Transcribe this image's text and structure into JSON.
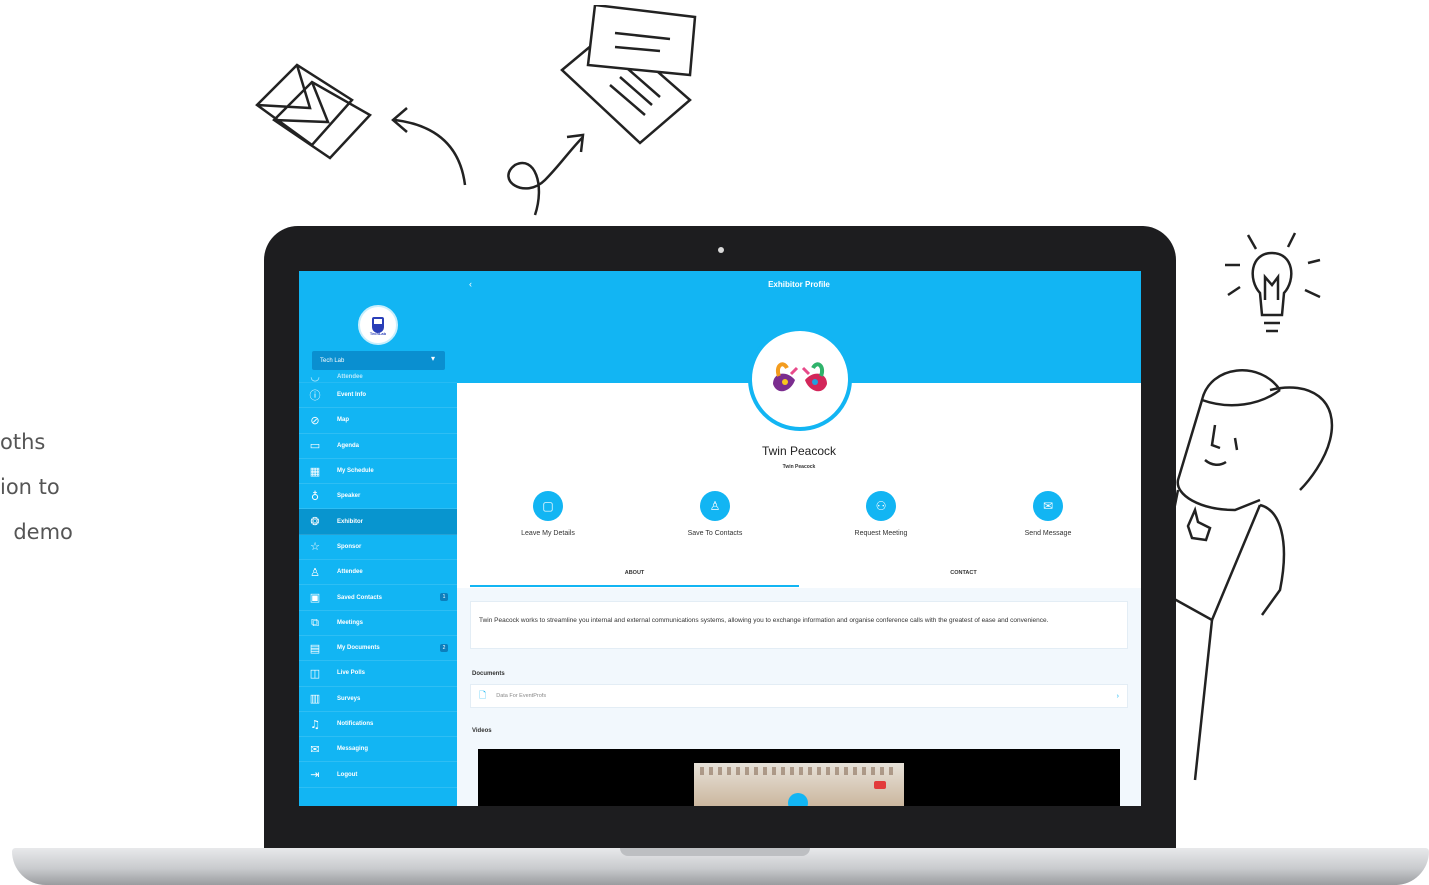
{
  "marketing_text": [
    "oths",
    "ion to",
    "  demo"
  ],
  "app": {
    "page_title": "Exhibitor Profile",
    "back_icon": "chevron-left-icon",
    "org": {
      "name": "Tech Lab",
      "logo_text": "TechLab"
    },
    "sidebar": {
      "partial_item": "Attendee",
      "items": [
        {
          "label": "Event Info",
          "icon": "info-icon"
        },
        {
          "label": "Map",
          "icon": "compass-icon"
        },
        {
          "label": "Agenda",
          "icon": "calendar-icon"
        },
        {
          "label": "My Schedule",
          "icon": "schedule-icon"
        },
        {
          "label": "Speaker",
          "icon": "microphone-icon"
        },
        {
          "label": "Exhibitor",
          "icon": "exhibitor-icon",
          "active": true
        },
        {
          "label": "Sponsor",
          "icon": "star-icon"
        },
        {
          "label": "Attendee",
          "icon": "user-icon"
        },
        {
          "label": "Saved Contacts",
          "icon": "contacts-icon",
          "badge": "1"
        },
        {
          "label": "Meetings",
          "icon": "meetings-icon"
        },
        {
          "label": "My Documents",
          "icon": "documents-icon",
          "badge": "2"
        },
        {
          "label": "Live Polls",
          "icon": "poll-icon"
        },
        {
          "label": "Surveys",
          "icon": "survey-icon"
        },
        {
          "label": "Notifications",
          "icon": "bell-icon"
        },
        {
          "label": "Messaging",
          "icon": "mail-icon"
        },
        {
          "label": "Logout",
          "icon": "logout-icon"
        }
      ]
    },
    "exhibitor": {
      "name": "Twin Peacock",
      "subtitle": "Twin Peacock"
    },
    "actions": [
      {
        "label": "Leave My Details",
        "icon": "note-icon"
      },
      {
        "label": "Save To Contacts",
        "icon": "add-user-icon"
      },
      {
        "label": "Request Meeting",
        "icon": "group-icon"
      },
      {
        "label": "Send Message",
        "icon": "envelope-icon"
      }
    ],
    "tabs": [
      {
        "label": "ABOUT",
        "active": true
      },
      {
        "label": "CONTACT",
        "active": false
      }
    ],
    "about_text": "Twin Peacock works to streamline you internal and external communications systems, allowing you to exchange information and organise conference calls with the greatest of ease and convenience.",
    "documents": {
      "heading": "Documents",
      "items": [
        {
          "name": "Data For EventProfs"
        }
      ]
    },
    "videos": {
      "heading": "Videos"
    }
  },
  "colors": {
    "accent": "#12b5f3",
    "sidebar_active": "#0895cf",
    "laptop": "#1d1d1f"
  }
}
